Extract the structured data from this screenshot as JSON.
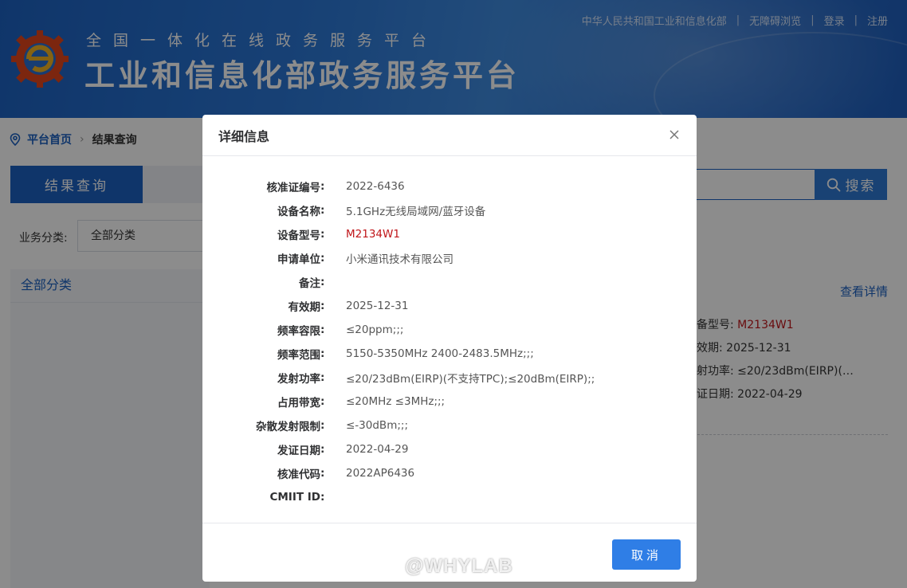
{
  "header": {
    "subtitle": "全国一体化在线政务服务平台",
    "title": "工业和信息化部政务服务平台",
    "links": [
      "中华人民共和国工业和信息化部",
      "无障碍浏览",
      "登录",
      "注册"
    ],
    "separator": "|"
  },
  "breadcrumb": {
    "home": "平台首页",
    "current": "结果查询",
    "arrow": "›"
  },
  "tab": {
    "label": "结果查询"
  },
  "search": {
    "button_label": "搜索"
  },
  "filter": {
    "label": "业务分类:",
    "selected": "全部分类"
  },
  "side_panel": {
    "heading": "全部分类"
  },
  "result": {
    "view_detail": "查看详情",
    "fields": [
      {
        "label": "备型号:",
        "value": "M2134W1",
        "highlight": true
      },
      {
        "label": "效期:",
        "value": "2025-12-31",
        "highlight": false
      },
      {
        "label": "射功率:",
        "value": "≤20/23dBm(EIRP)(…",
        "highlight": false
      },
      {
        "label": "证日期:",
        "value": "2022-04-29",
        "highlight": false
      }
    ]
  },
  "modal": {
    "title": "详细信息",
    "close_icon": "close-icon",
    "colon": ":",
    "rows": [
      {
        "label": "核准证编号",
        "value": "2022-6436",
        "highlight": false
      },
      {
        "label": "设备名称",
        "value": "5.1GHz无线局域网/蓝牙设备",
        "highlight": false
      },
      {
        "label": "设备型号",
        "value": "M2134W1",
        "highlight": true
      },
      {
        "label": "申请单位",
        "value": "小米通讯技术有限公司",
        "highlight": false
      },
      {
        "label": "备注",
        "value": "",
        "highlight": false
      },
      {
        "label": "有效期",
        "value": "2025-12-31",
        "highlight": false
      },
      {
        "label": "频率容限",
        "value": "≤20ppm;;;",
        "highlight": false
      },
      {
        "label": "频率范围",
        "value": "5150-5350MHz 2400-2483.5MHz;;;",
        "highlight": false
      },
      {
        "label": "发射功率",
        "value": "≤20/23dBm(EIRP)(不支持TPC);≤20dBm(EIRP);;",
        "highlight": false
      },
      {
        "label": "占用带宽",
        "value": "≤20MHz ≤3MHz;;;",
        "highlight": false
      },
      {
        "label": "杂散发射限制",
        "value": "≤-30dBm;;;",
        "highlight": false
      },
      {
        "label": "发证日期",
        "value": "2022-04-29",
        "highlight": false
      },
      {
        "label": "核准代码",
        "value": "2022AP6436",
        "highlight": false
      },
      {
        "label": "CMIIT ID",
        "value": "",
        "highlight": false
      }
    ],
    "cancel_label": "取消"
  },
  "watermark": {
    "text": "@WHYLAB"
  },
  "colors": {
    "brand_blue": "#1d62c2",
    "highlight_red": "#c0161a",
    "button_blue": "#2f7ee6"
  }
}
